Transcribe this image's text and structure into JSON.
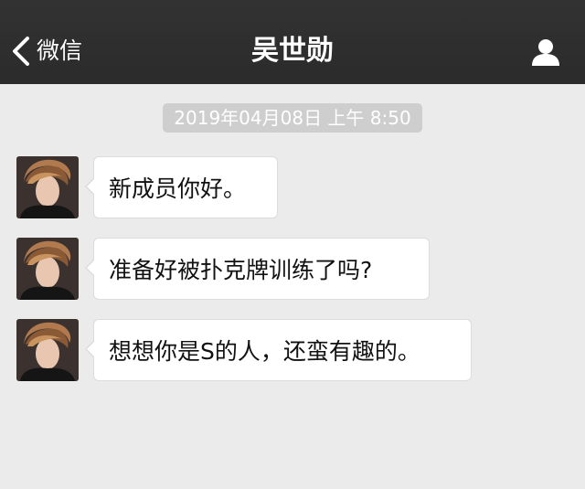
{
  "navbar": {
    "back_label": "微信",
    "title": "吴世勋",
    "back_icon": "chevron-left-icon",
    "profile_icon": "person-icon"
  },
  "timestamp": "2019年04月08日 上午 8:50",
  "messages": [
    {
      "text": "新成员你好。"
    },
    {
      "text": "准备好被扑克牌训练了吗?"
    },
    {
      "text": "想想你是S的人，还蛮有趣的。"
    }
  ],
  "colors": {
    "navbar_bg": "#2e2e2e",
    "chat_bg": "#ebebeb",
    "bubble_bg": "#ffffff",
    "timestamp_bg": "#cecece"
  }
}
